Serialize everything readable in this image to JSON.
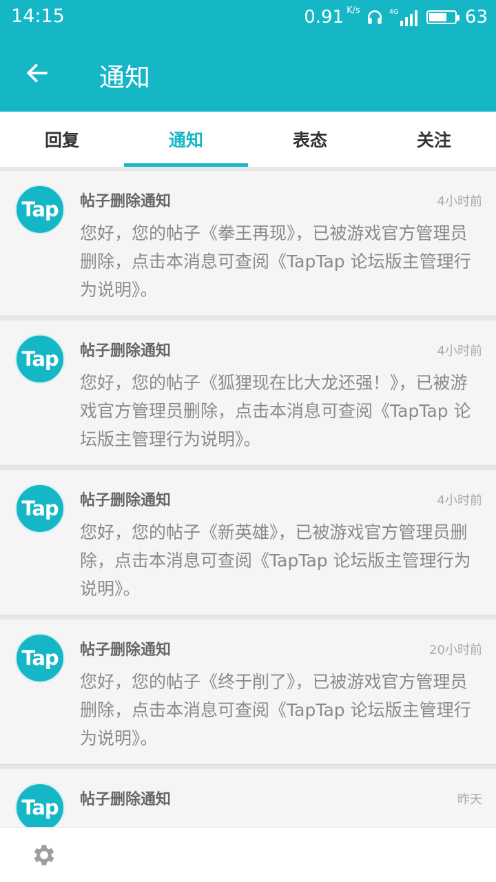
{
  "status": {
    "time": "14:15",
    "net_speed": "0.91",
    "net_unit": "K/s",
    "network": "4G",
    "battery": "63"
  },
  "header": {
    "title": "通知"
  },
  "tabs": [
    {
      "label": "回复"
    },
    {
      "label": "通知"
    },
    {
      "label": "表态"
    },
    {
      "label": "关注"
    }
  ],
  "active_tab": "通知",
  "notifications": [
    {
      "avatar": "Tap",
      "title": "帖子删除通知",
      "time": "4小时前",
      "body": "您好，您的帖子《拳王再现》，已被游戏官方管理员删除，点击本消息可查阅《TapTap 论坛版主管理行为说明》。"
    },
    {
      "avatar": "Tap",
      "title": "帖子删除通知",
      "time": "4小时前",
      "body": "您好，您的帖子《狐狸现在比大龙还强！》，已被游戏官方管理员删除，点击本消息可查阅《TapTap 论坛版主管理行为说明》。"
    },
    {
      "avatar": "Tap",
      "title": "帖子删除通知",
      "time": "4小时前",
      "body": "您好，您的帖子《新英雄》，已被游戏官方管理员删除，点击本消息可查阅《TapTap 论坛版主管理行为说明》。"
    },
    {
      "avatar": "Tap",
      "title": "帖子删除通知",
      "time": "20小时前",
      "body": "您好，您的帖子《终于削了》，已被游戏官方管理员删除，点击本消息可查阅《TapTap 论坛版主管理行为说明》。"
    },
    {
      "avatar": "Tap",
      "title": "帖子删除通知",
      "time": "昨天",
      "body": ""
    }
  ],
  "icons": {
    "back": "arrow-left-icon",
    "settings": "gear-icon"
  },
  "colors": {
    "accent": "#15b7c6"
  }
}
